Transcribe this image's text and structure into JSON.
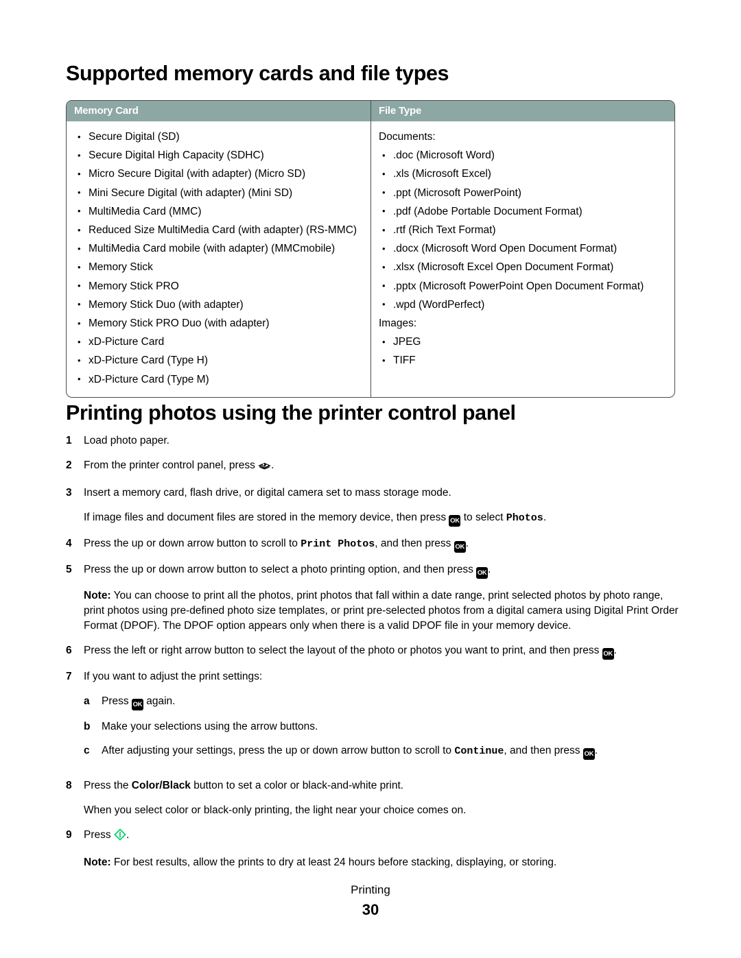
{
  "sections": {
    "cards_heading": "Supported memory cards and file types",
    "print_heading": "Printing photos using the printer control panel"
  },
  "table": {
    "headers": {
      "memory_card": "Memory Card",
      "file_type": "File Type"
    },
    "memory_cards": [
      "Secure Digital (SD)",
      "Secure Digital High Capacity (SDHC)",
      "Micro Secure Digital (with adapter) (Micro SD)",
      "Mini Secure Digital (with adapter) (Mini SD)",
      "MultiMedia Card (MMC)",
      "Reduced Size MultiMedia Card (with adapter) (RS-MMC)",
      "MultiMedia Card mobile (with adapter) (MMCmobile)",
      "Memory Stick",
      "Memory Stick PRO",
      "Memory Stick Duo (with adapter)",
      "Memory Stick PRO Duo (with adapter)",
      "xD-Picture Card",
      "xD-Picture Card (Type H)",
      "xD-Picture Card (Type M)"
    ],
    "file_types": {
      "documents_label": "Documents:",
      "documents": [
        ".doc (Microsoft Word)",
        ".xls (Microsoft Excel)",
        ".ppt (Microsoft PowerPoint)",
        ".pdf (Adobe Portable Document Format)",
        ".rtf (Rich Text Format)",
        ".docx (Microsoft Word Open Document Format)",
        ".xlsx (Microsoft Excel Open Document Format)",
        ".pptx (Microsoft PowerPoint Open Document Format)",
        ".wpd (WordPerfect)"
      ],
      "images_label": "Images:",
      "images": [
        "JPEG",
        "TIFF"
      ]
    }
  },
  "steps": {
    "s1": {
      "num": "1",
      "text": "Load photo paper."
    },
    "s2": {
      "num": "2",
      "text_before": "From the printer control panel, press",
      "icon": "photo-card-icon",
      "text_after": "."
    },
    "s3": {
      "num": "3",
      "line1": "Insert a memory card, flash drive, or digital camera set to mass storage mode.",
      "line2_before": "If image files and document files are stored in the memory device, then press",
      "line2_icon": "ok-button-icon",
      "line2_mid": "to select",
      "line2_mono": "Photos",
      "line2_after": "."
    },
    "s4": {
      "num": "4",
      "before": "Press the up or down arrow button to scroll to",
      "mono": "Print Photos",
      "mid": ", and then press",
      "icon": "ok-button-icon",
      "after": "."
    },
    "s5": {
      "num": "5",
      "before": "Press the up or down arrow button to select a photo printing option, and then press",
      "icon": "ok-button-icon",
      "after": "."
    },
    "note5": {
      "label": "Note:",
      "text": " You can choose to print all the photos, print photos that fall within a date range, print selected photos by photo range, print photos using pre-defined photo size templates, or print pre-selected photos from a digital camera using Digital Print Order Format (DPOF). The DPOF option appears only when there is a valid DPOF file in your memory device."
    },
    "s6": {
      "num": "6",
      "before": "Press the left or right arrow button to select the layout of the photo or photos you want to print, and then press",
      "icon": "ok-button-icon",
      "after": "."
    },
    "s7": {
      "num": "7",
      "text": "If you want to adjust the print settings:",
      "sub_a": {
        "letter": "a",
        "before": "Press",
        "icon": "ok-button-icon",
        "after": "again."
      },
      "sub_b": {
        "letter": "b",
        "text": "Make your selections using the arrow buttons."
      },
      "sub_c": {
        "letter": "c",
        "before": "After adjusting your settings, press the up or down arrow button to scroll to",
        "mono": "Continue",
        "mid": ", and then press",
        "icon": "ok-button-icon",
        "after": "."
      }
    },
    "s8": {
      "num": "8",
      "before": "Press the",
      "strong": "Color/Black",
      "after": " button to set a color or black-and-white print.",
      "line2": "When you select color or black-only printing, the light near your choice comes on."
    },
    "s9": {
      "num": "9",
      "before": "Press",
      "icon": "start-button-icon",
      "after": "."
    },
    "note9": {
      "label": "Note:",
      "text": " For best results, allow the prints to dry at least 24 hours before stacking, displaying, or storing."
    }
  },
  "footer": {
    "chapter": "Printing",
    "page_number": "30"
  },
  "colors": {
    "table_header_bg": "#8da7a4",
    "table_border": "#4b4b4b",
    "start_icon_green": "#00cc66",
    "ok_icon_bg": "#000000"
  }
}
